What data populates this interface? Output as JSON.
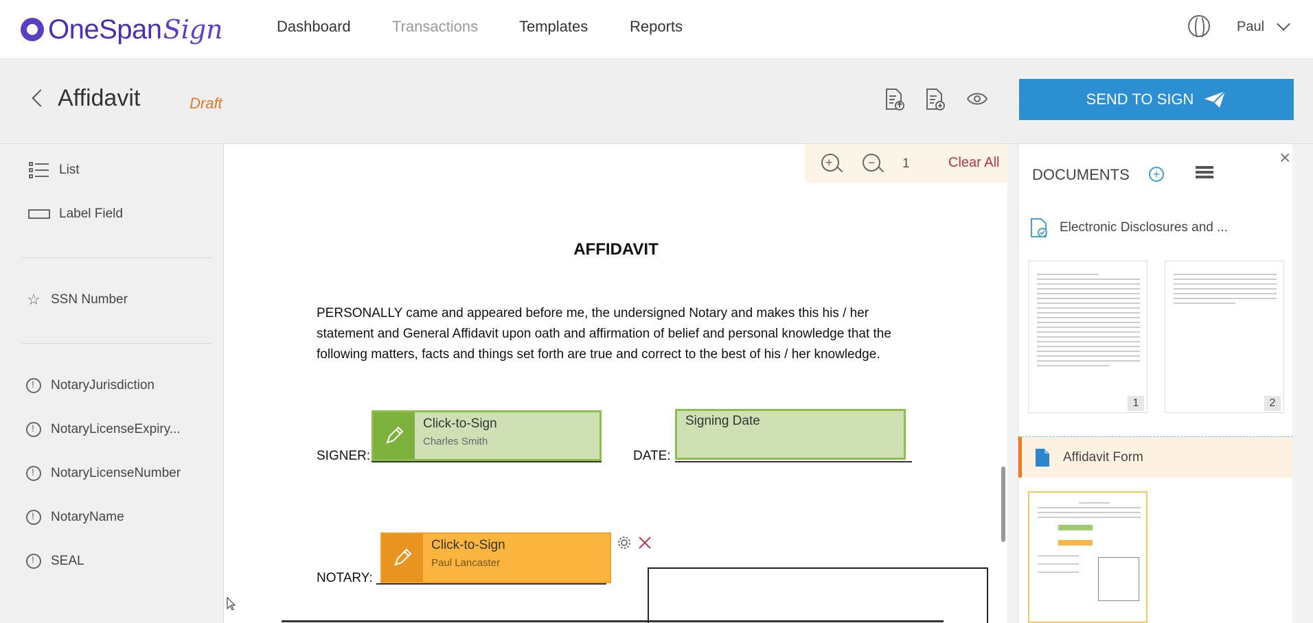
{
  "brand": {
    "name": "OneSpan",
    "script": "Sign"
  },
  "nav": {
    "items": [
      "Dashboard",
      "Transactions",
      "Templates",
      "Reports"
    ],
    "user": "Paul"
  },
  "header": {
    "title": "Affidavit",
    "status": "Draft",
    "send_label": "SEND TO SIGN"
  },
  "left_panel": {
    "items": [
      "List",
      "Label Field",
      "SSN Number",
      "NotaryJurisdiction",
      "NotaryLicenseExpiry...",
      "NotaryLicenseNumber",
      "NotaryName",
      "SEAL"
    ]
  },
  "toolbar": {
    "page": "1",
    "clear_all": "Clear All"
  },
  "document": {
    "heading": "AFFIDAVIT",
    "body": "PERSONALLY came and appeared before me, the undersigned Notary and makes this his / her statement and General Affidavit upon oath and affirmation of belief and personal knowledge that the following matters, facts and things set forth are true and correct to the best of his / her knowledge.",
    "signer_label": "SIGNER:",
    "date_label": "DATE:",
    "notary_label": "NOTARY:",
    "signer_field": {
      "title": "Click-to-Sign",
      "name": "Charles Smith"
    },
    "date_field": {
      "title": "Signing Date"
    },
    "notary_field": {
      "title": "Click-to-Sign",
      "name": "Paul Lancaster"
    }
  },
  "documents_panel": {
    "title": "DOCUMENTS",
    "docs": [
      {
        "name": "Electronic Disclosures and ...",
        "pages": [
          "1",
          "2"
        ]
      },
      {
        "name": "Affidavit Form"
      }
    ]
  },
  "colors": {
    "accent": "#2b8fd1",
    "draft": "#e07b25",
    "signer": "#8cbf4a",
    "notary": "#fbb53e",
    "clear": "#b83547"
  }
}
